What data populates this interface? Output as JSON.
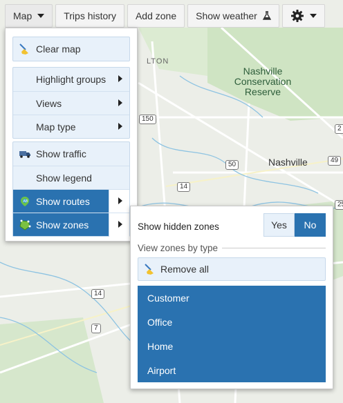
{
  "toolbar": {
    "map_label": "Map",
    "trips_history_label": "Trips history",
    "add_zone_label": "Add zone",
    "show_weather_label": "Show weather"
  },
  "map": {
    "reserve_label": [
      "Nashville",
      "Conservation",
      "Reserve"
    ],
    "city_label": "Nashville",
    "faded_label": "LTON",
    "shields": [
      "150",
      "50",
      "14",
      "49",
      "14",
      "7",
      "2",
      "25"
    ]
  },
  "menu": {
    "clear_map": "Clear map",
    "highlight_groups": "Highlight groups",
    "views": "Views",
    "map_type": "Map type",
    "show_traffic": "Show traffic",
    "show_legend": "Show legend",
    "show_routes": "Show routes",
    "show_zones": "Show zones"
  },
  "zones_panel": {
    "show_hidden_label": "Show hidden zones",
    "yes_label": "Yes",
    "no_label": "No",
    "selected_option": "No",
    "view_by_type_label": "View zones by type",
    "remove_all_label": "Remove all",
    "types": [
      "Customer",
      "Office",
      "Home",
      "Airport"
    ]
  },
  "colors": {
    "accent": "#2a72b0",
    "group_bg": "#e8f1fa"
  }
}
